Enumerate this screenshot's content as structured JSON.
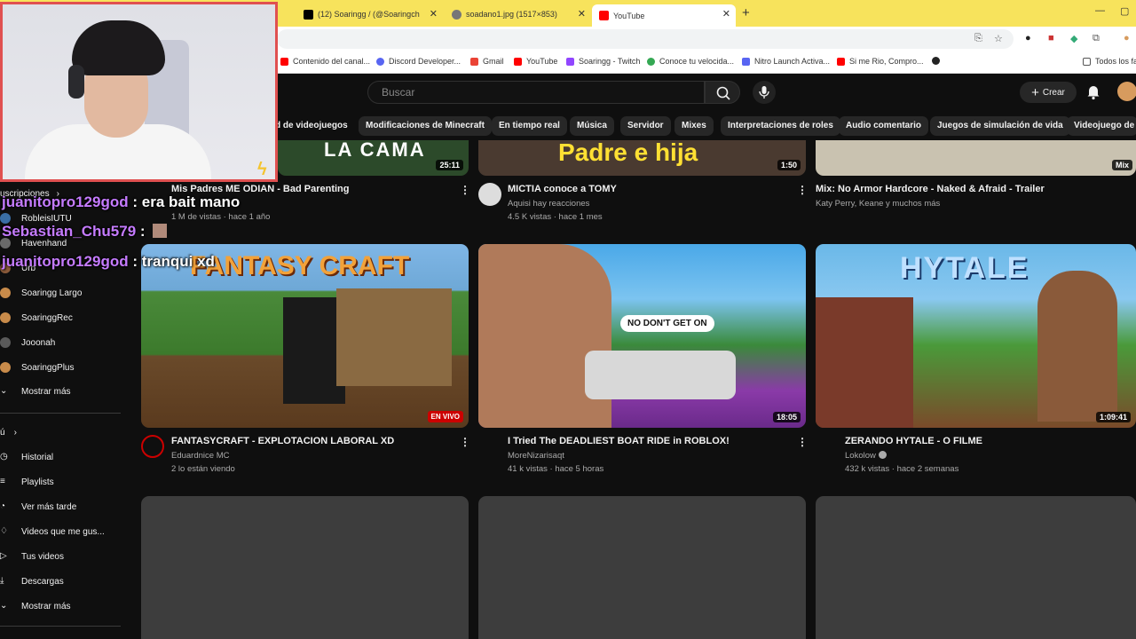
{
  "browser": {
    "tabs": [
      {
        "title": "(12) Soaringg / (@Soaringch",
        "icon": "x-icon"
      },
      {
        "title": "soadano1.jpg (1517×853)",
        "icon": "globe-icon"
      },
      {
        "title": "YouTube",
        "icon": "youtube-icon",
        "active": true
      }
    ],
    "new_tab": "+",
    "bookmarks": [
      {
        "label": "Contenido del canal...",
        "color": "#ff0000"
      },
      {
        "label": "Discord Developer...",
        "color": "#5865f2"
      },
      {
        "label": "Gmail",
        "color": "#ea4335"
      },
      {
        "label": "YouTube",
        "color": "#ff0000"
      },
      {
        "label": "Soaringg - Twitch",
        "color": "#9146ff"
      },
      {
        "label": "Conoce tu velocida...",
        "color": "#34a853"
      },
      {
        "label": "Nitro Launch Activa...",
        "color": "#5865f2"
      },
      {
        "label": "Si me Rio, Compro...",
        "color": "#ff0000"
      }
    ],
    "all_bookmarks": "Todos los fa"
  },
  "youtube": {
    "search_placeholder": "Buscar",
    "create_label": "Crear",
    "chips": [
      "d de videojuegos",
      "Modificaciones de Minecraft",
      "En tiempo real",
      "Música",
      "Servidor",
      "Mixes",
      "Interpretaciones de roles",
      "Audio comentario",
      "Juegos de simulación de vida",
      "Videojuego de"
    ]
  },
  "sidebar": {
    "subscriptions_header": "uscripciones",
    "channels": [
      "RobleisIUTU",
      "Havenhand",
      "Urb",
      "Soaringg Largo",
      "SoaringgRec",
      "Jooonah",
      "SoaringgPlus"
    ],
    "show_more_1": "Mostrar más",
    "you_header": "ú",
    "items": [
      "Historial",
      "Playlists",
      "Ver más tarde",
      "Videos que me gus...",
      "Tus videos",
      "Descargas"
    ],
    "show_more_2": "Mostrar más"
  },
  "videos_row1": [
    {
      "title": "Mis Padres ME ODIAN - Bad Parenting",
      "meta2": "1 M de vistas · hace 1 año",
      "duration": "25:11",
      "thumb_text": "LA CAMA"
    },
    {
      "title": "MICTIA conoce a TOMY",
      "meta1": "Aquisi hay reacciones",
      "meta2": "4.5 K vistas · hace 1 mes",
      "duration": "1:50",
      "thumb_text": "Padre e hija"
    },
    {
      "title": "Mix: No Armor Hardcore - Naked & Afraid - Trailer",
      "meta1": "Katy Perry, Keane y muchos más",
      "duration": "Mix"
    }
  ],
  "videos_row2": [
    {
      "title": "FANTASYCRAFT - EXPLOTACION LABORAL XD",
      "meta1": "Eduardnice MC",
      "meta2": "2 lo están viendo",
      "badge": "EN VIVO",
      "thumb_text": "FANTASY CRAFT"
    },
    {
      "title": "I Tried The DEADLIEST BOAT RIDE in ROBLOX!",
      "meta1": "MoreNizarisaqt",
      "meta2": "41 k vistas · hace 5 horas",
      "duration": "18:05",
      "thumb_text": "NO DON'T GET ON"
    },
    {
      "title": "ZERANDO HYTALE - O FILME",
      "meta1": "Lokolow",
      "meta2": "432 k vistas · hace 2 semanas",
      "duration": "1:09:41",
      "thumb_text": "HYTALE"
    }
  ],
  "chat": [
    {
      "user": "juanitopro129god",
      "message": ": era bait mano"
    },
    {
      "user": "Sebastian_Chu579",
      "message": ":"
    },
    {
      "user": "juanitopro129god",
      "message": ": tranqui xd"
    }
  ]
}
